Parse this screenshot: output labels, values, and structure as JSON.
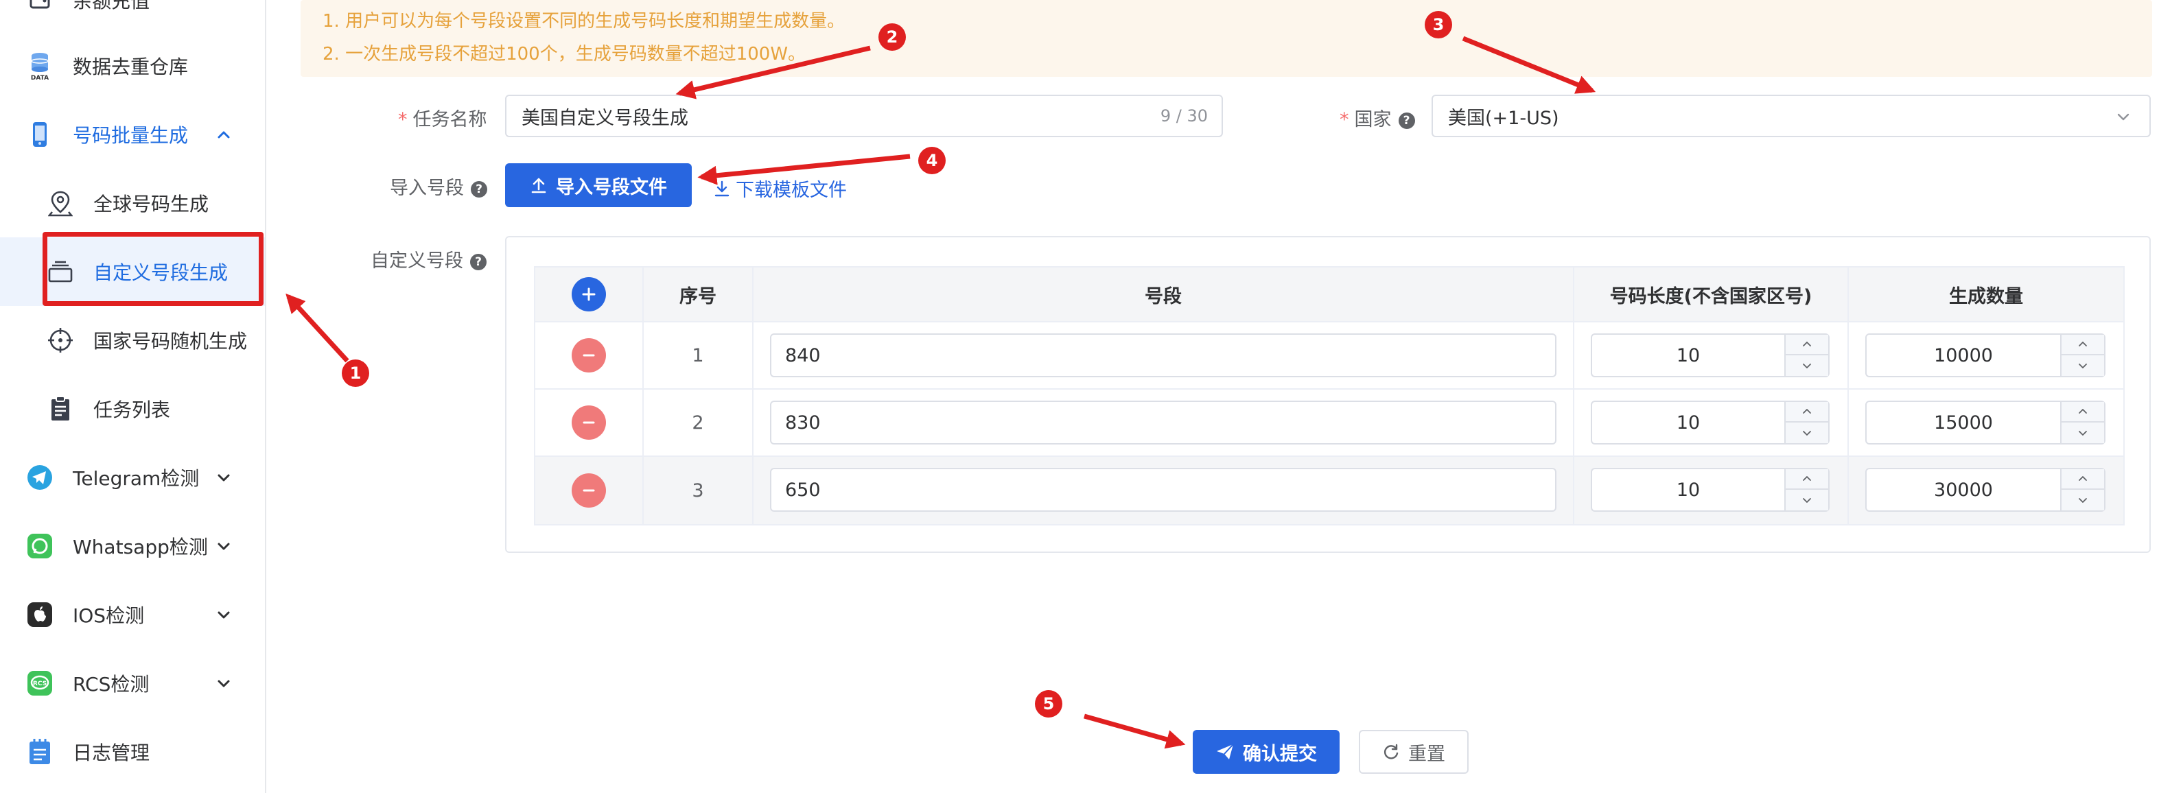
{
  "sidebar": {
    "items": [
      {
        "label": "余额充值",
        "icon": "wallet-icon"
      },
      {
        "label": "数据去重仓库",
        "icon": "database-icon"
      },
      {
        "label": "号码批量生成",
        "icon": "phone-icon",
        "state": "open"
      },
      {
        "label": "全球号码生成",
        "icon": "location-pin-icon"
      },
      {
        "label": "自定义号段生成",
        "icon": "layers-icon",
        "state": "active"
      },
      {
        "label": "国家号码随机生成",
        "icon": "crosshair-icon"
      },
      {
        "label": "任务列表",
        "icon": "clipboard-icon"
      },
      {
        "label": "Telegram检测",
        "icon": "telegram-icon"
      },
      {
        "label": "Whatsapp检测",
        "icon": "whatsapp-icon"
      },
      {
        "label": "IOS检测",
        "icon": "apple-icon"
      },
      {
        "label": "RCS检测",
        "icon": "rcs-icon"
      },
      {
        "label": "日志管理",
        "icon": "notebook-icon"
      }
    ]
  },
  "tips": [
    "1. 用户可以为每个号段设置不同的生成号码长度和期望生成数量。",
    "2. 一次生成号段不超过100个，生成号码数量不超过100W。"
  ],
  "form": {
    "task_name": {
      "label": "任务名称",
      "required": "*",
      "value": "美国自定义号段生成",
      "count": "9 / 30"
    },
    "country": {
      "label": "国家",
      "required": "*",
      "value": "美国(+1-US)"
    },
    "import": {
      "label": "导入号段",
      "button": "导入号段文件",
      "template_link": "下载模板文件"
    },
    "custom": {
      "label": "自定义号段"
    }
  },
  "table": {
    "headers": [
      "序号",
      "号段",
      "号码长度(不含国家区号)",
      "生成数量"
    ],
    "rows": [
      {
        "index": "1",
        "segment": "840",
        "length": "10",
        "quantity": "10000"
      },
      {
        "index": "2",
        "segment": "830",
        "length": "10",
        "quantity": "15000"
      },
      {
        "index": "3",
        "segment": "650",
        "length": "10",
        "quantity": "30000"
      }
    ]
  },
  "actions": {
    "submit": "确认提交",
    "reset": "重置"
  },
  "annotations": [
    "1",
    "2",
    "3",
    "4",
    "5"
  ],
  "colors": {
    "primary": "#2866e0",
    "danger": "#f07a7a",
    "annotation": "#e02020",
    "tip_text": "#e6a23c",
    "tip_bg": "#fdf6ec"
  }
}
